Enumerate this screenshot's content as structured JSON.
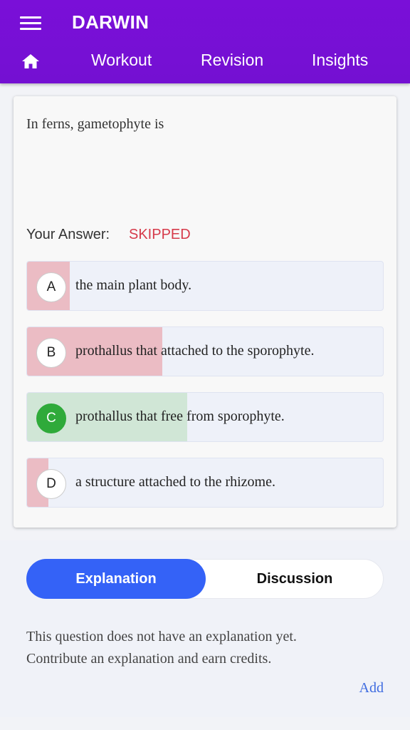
{
  "header": {
    "app_title": "DARWIN",
    "nav": {
      "workout": "Workout",
      "revision": "Revision",
      "insights": "Insights"
    }
  },
  "question": {
    "text": "In ferns, gametophyte is",
    "answer_label": "Your Answer:",
    "answer_value": "SKIPPED",
    "options": [
      {
        "letter": "A",
        "text": "the main plant body.",
        "status": "wrong",
        "response_share": 0.12
      },
      {
        "letter": "B",
        "text": "prothallus that attached to the sporophyte.",
        "status": "wrong",
        "response_share": 0.38
      },
      {
        "letter": "C",
        "text": "prothallus that free from sporophyte.",
        "status": "correct",
        "response_share": 0.45
      },
      {
        "letter": "D",
        "text": "a structure attached to the rhizome.",
        "status": "wrong",
        "response_share": 0.06
      }
    ]
  },
  "explanation": {
    "tabs": {
      "explanation": "Explanation",
      "discussion": "Discussion"
    },
    "active_tab": "Explanation",
    "line1": "This question does not have an explanation yet.",
    "line2": "Contribute an explanation and earn credits.",
    "add_label": "Add"
  },
  "colors": {
    "header": "#7a0fd8",
    "skipped": "#d63a4a",
    "wrong_fill": "#ebbcc4",
    "correct_fill": "#d0e6d6",
    "correct_badge": "#2faa3a",
    "active_tab": "#3462f7",
    "link": "#3f6ce0"
  },
  "icons": {
    "menu": "hamburger-menu-icon",
    "home": "home-icon"
  }
}
